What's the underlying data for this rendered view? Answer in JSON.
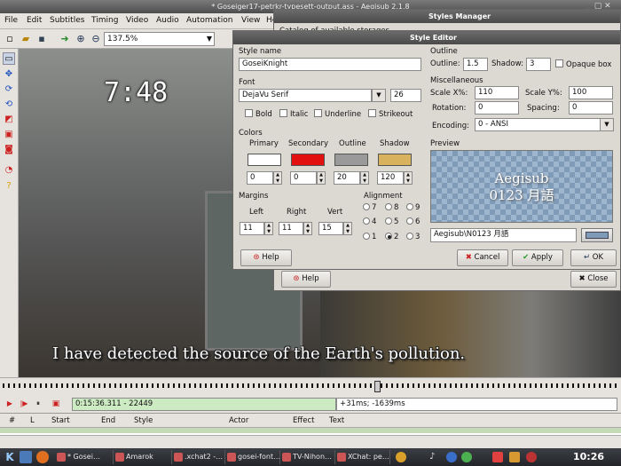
{
  "window": {
    "title": "* Goseiger17-petrkr-typesett-output.ass - Aegisub 2.1.8"
  },
  "menu": [
    "File",
    "Edit",
    "Subtitles",
    "Timing",
    "Video",
    "Audio",
    "Automation",
    "View",
    "Help"
  ],
  "toolbar": {
    "zoom": "137.5%"
  },
  "video": {
    "clock": "7:48",
    "subtitle": "I have detected the source of the Earth's pollution."
  },
  "styles_manager": {
    "title": "Styles Manager",
    "catalog_label": "Catalog of available storages",
    "help": "Help",
    "close": "Close"
  },
  "style_editor": {
    "title": "Style Editor",
    "style_name_label": "Style name",
    "style_name": "GoseiKnight",
    "font_label": "Font",
    "font_name": "DejaVu Serif",
    "font_size": "26",
    "bold": "Bold",
    "italic": "Italic",
    "underline": "Underline",
    "strikeout": "Strikeout",
    "colors_label": "Colors",
    "colors": [
      {
        "label": "Primary",
        "color": "#ffffff",
        "alpha": "0"
      },
      {
        "label": "Secondary",
        "color": "#e31010",
        "alpha": "0"
      },
      {
        "label": "Outline",
        "color": "#9a9a9a",
        "alpha": "20"
      },
      {
        "label": "Shadow",
        "color": "#d8b25c",
        "alpha": "120"
      }
    ],
    "margins_label": "Margins",
    "margin_left_label": "Left",
    "margin_right_label": "Right",
    "margin_vert_label": "Vert",
    "margin_left": "11",
    "margin_right": "11",
    "margin_vert": "15",
    "alignment_label": "Alignment",
    "alignment": [
      "7",
      "8",
      "9",
      "4",
      "5",
      "6",
      "1",
      "2",
      "3"
    ],
    "alignment_selected": "2",
    "outline_label": "Outline",
    "outline_field_label": "Outline:",
    "outline": "1.5",
    "shadow_label": "Shadow:",
    "shadow": "3",
    "opaque_box": "Opaque box",
    "misc_label": "Miscellaneous",
    "scale_x_label": "Scale X%:",
    "scale_x": "110",
    "scale_y_label": "Scale Y%:",
    "scale_y": "100",
    "rotation_label": "Rotation:",
    "rotation": "0",
    "spacing_label": "Spacing:",
    "spacing": "0",
    "encoding_label": "Encoding:",
    "encoding": "0 - ANSI",
    "preview_label": "Preview",
    "preview_line1": "Aegisub",
    "preview_line2": "0123 月語",
    "preview_text": "Aegisub\\N0123 月語",
    "preview_bg": "#7f9bb8",
    "help": "Help",
    "cancel": "Cancel",
    "apply": "Apply",
    "ok": "OK"
  },
  "seek": {
    "time": "0:15:36.311 - 22449",
    "offset": "+31ms; -1639ms"
  },
  "grid": {
    "columns": [
      "#",
      "L",
      "Start",
      "End",
      "Style",
      "Actor",
      "Effect",
      "Text"
    ]
  },
  "taskbar": {
    "tasks": [
      "* Gosei…",
      "Amarok",
      ".xchat2 -…",
      "gosei-font…",
      "TV-Nihon…",
      "XChat: pe…"
    ],
    "clock": "10:26"
  }
}
